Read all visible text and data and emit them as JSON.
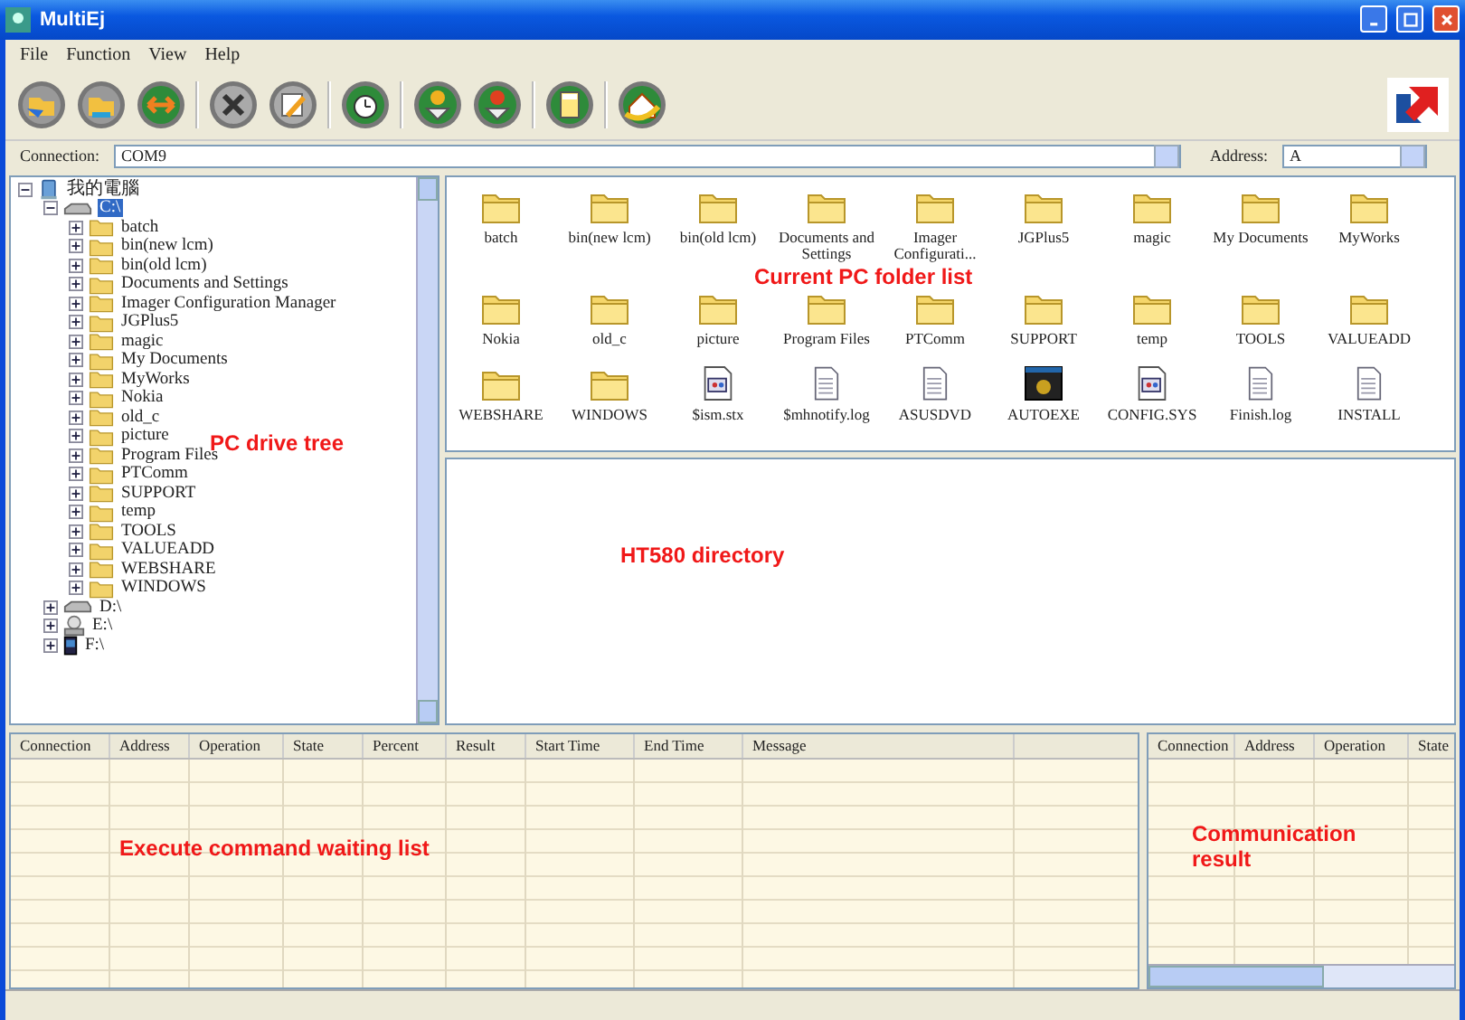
{
  "window": {
    "title": "MultiEj"
  },
  "menu": [
    "File",
    "Function",
    "View",
    "Help"
  ],
  "toolbar": [
    {
      "kind": "folder-in"
    },
    {
      "kind": "folder-out"
    },
    {
      "kind": "swap"
    },
    {
      "kind": "separator"
    },
    {
      "kind": "cross"
    },
    {
      "kind": "pencil"
    },
    {
      "kind": "separator"
    },
    {
      "kind": "clock"
    },
    {
      "kind": "separator"
    },
    {
      "kind": "download"
    },
    {
      "kind": "download-alert"
    },
    {
      "kind": "separator"
    },
    {
      "kind": "calculator"
    },
    {
      "kind": "separator"
    },
    {
      "kind": "home"
    }
  ],
  "connection_bar": {
    "connection_label": "Connection:",
    "connection_value": "COM9",
    "address_label": "Address:",
    "address_value": "A"
  },
  "tree": [
    {
      "label": "我的電腦",
      "kind": "computer",
      "expanded": true,
      "selected": false,
      "children": [
        {
          "label": "C:\\",
          "kind": "drive",
          "expanded": true,
          "selected": true,
          "children": [
            {
              "label": "batch",
              "kind": "folder",
              "expanded": false,
              "selected": false
            },
            {
              "label": "bin(new lcm)",
              "kind": "folder",
              "expanded": false,
              "selected": false
            },
            {
              "label": "bin(old lcm)",
              "kind": "folder",
              "expanded": false,
              "selected": false
            },
            {
              "label": "Documents and Settings",
              "kind": "folder",
              "expanded": false,
              "selected": false
            },
            {
              "label": "Imager Configuration Manager",
              "kind": "folder",
              "expanded": false,
              "selected": false
            },
            {
              "label": "JGPlus5",
              "kind": "folder",
              "expanded": false,
              "selected": false
            },
            {
              "label": "magic",
              "kind": "folder",
              "expanded": false,
              "selected": false
            },
            {
              "label": "My Documents",
              "kind": "folder",
              "expanded": false,
              "selected": false
            },
            {
              "label": "MyWorks",
              "kind": "folder",
              "expanded": false,
              "selected": false
            },
            {
              "label": "Nokia",
              "kind": "folder",
              "expanded": false,
              "selected": false
            },
            {
              "label": "old_c",
              "kind": "folder",
              "expanded": false,
              "selected": false
            },
            {
              "label": "picture",
              "kind": "folder",
              "expanded": false,
              "selected": false
            },
            {
              "label": "Program Files",
              "kind": "folder",
              "expanded": false,
              "selected": false
            },
            {
              "label": "PTComm",
              "kind": "folder",
              "expanded": false,
              "selected": false
            },
            {
              "label": "SUPPORT",
              "kind": "folder",
              "expanded": false,
              "selected": false
            },
            {
              "label": "temp",
              "kind": "folder",
              "expanded": false,
              "selected": false
            },
            {
              "label": "TOOLS",
              "kind": "folder",
              "expanded": false,
              "selected": false
            },
            {
              "label": "VALUEADD",
              "kind": "folder",
              "expanded": false,
              "selected": false
            },
            {
              "label": "WEBSHARE",
              "kind": "folder",
              "expanded": false,
              "selected": false
            },
            {
              "label": "WINDOWS",
              "kind": "folder",
              "expanded": false,
              "selected": false
            }
          ]
        },
        {
          "label": "D:\\",
          "kind": "drive",
          "expanded": false,
          "selected": false
        },
        {
          "label": "E:\\",
          "kind": "cdrom",
          "expanded": false,
          "selected": false
        },
        {
          "label": "F:\\",
          "kind": "device",
          "expanded": false,
          "selected": false
        }
      ]
    }
  ],
  "folder_list": {
    "annotation": "Current PC folder list",
    "items": [
      {
        "name": "batch",
        "kind": "folder"
      },
      {
        "name": "bin(new lcm)",
        "kind": "folder"
      },
      {
        "name": "bin(old lcm)",
        "kind": "folder"
      },
      {
        "name": "Documents and Settings",
        "kind": "folder"
      },
      {
        "name": "Imager Configurati...",
        "kind": "folder"
      },
      {
        "name": "JGPlus5",
        "kind": "folder"
      },
      {
        "name": "magic",
        "kind": "folder"
      },
      {
        "name": "My Documents",
        "kind": "folder"
      },
      {
        "name": "MyWorks",
        "kind": "folder"
      },
      {
        "name": "Nokia",
        "kind": "folder"
      },
      {
        "name": "old_c",
        "kind": "folder"
      },
      {
        "name": "picture",
        "kind": "folder"
      },
      {
        "name": "Program Files",
        "kind": "folder"
      },
      {
        "name": "PTComm",
        "kind": "folder"
      },
      {
        "name": "SUPPORT",
        "kind": "folder"
      },
      {
        "name": "temp",
        "kind": "folder"
      },
      {
        "name": "TOOLS",
        "kind": "folder"
      },
      {
        "name": "VALUEADD",
        "kind": "folder"
      },
      {
        "name": "WEBSHARE",
        "kind": "folder"
      },
      {
        "name": "WINDOWS",
        "kind": "folder"
      },
      {
        "name": "$ism.stx",
        "kind": "app-file"
      },
      {
        "name": "$mhnotify.log",
        "kind": "text-file"
      },
      {
        "name": "ASUSDVD",
        "kind": "text-file"
      },
      {
        "name": "AUTOEXE",
        "kind": "program"
      },
      {
        "name": "CONFIG.SYS",
        "kind": "app-file"
      },
      {
        "name": "Finish.log",
        "kind": "text-file"
      },
      {
        "name": "INSTALL",
        "kind": "text-file"
      }
    ]
  },
  "tree_annotation": "PC drive tree",
  "directory": {
    "annotation": "HT580 directory"
  },
  "waiting_list": {
    "annotation": "Execute command waiting list",
    "columns": [
      "Connection",
      "Address",
      "Operation",
      "State",
      "Percent",
      "Result",
      "Start Time",
      "End Time",
      "Message"
    ]
  },
  "result_list": {
    "annotation": "Communication result",
    "columns": [
      "Connection",
      "Address",
      "Operation",
      "State"
    ]
  }
}
